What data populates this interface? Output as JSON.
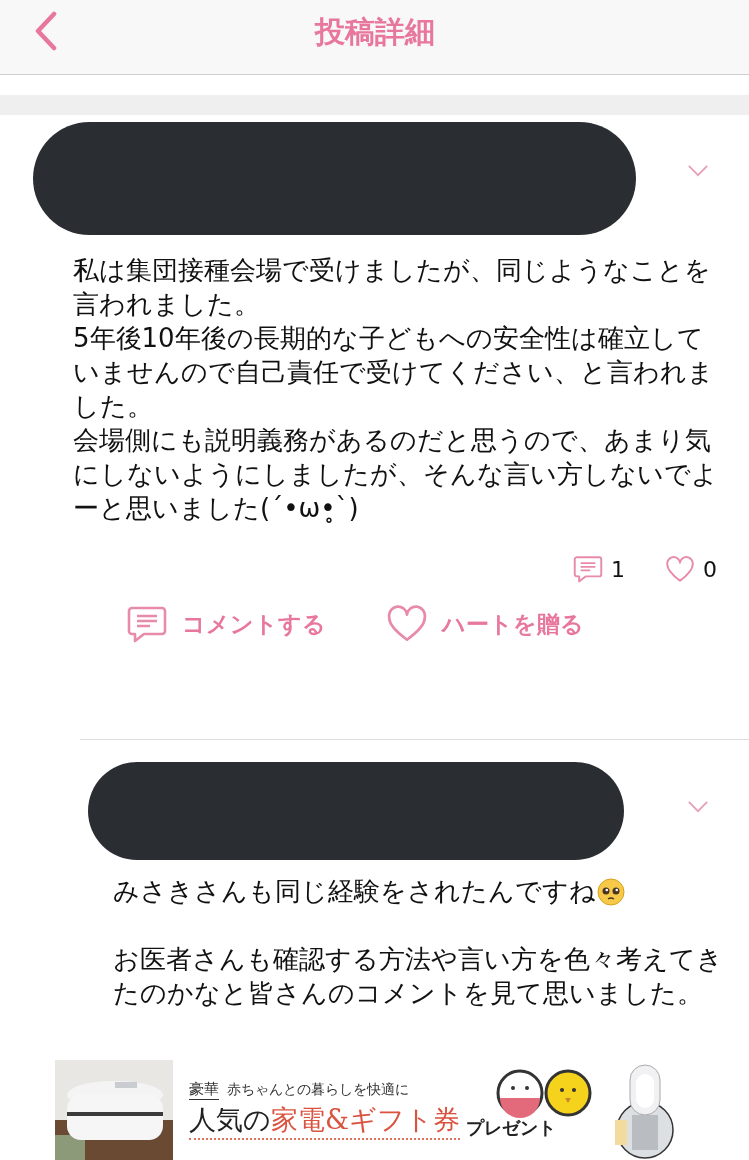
{
  "header": {
    "title": "投稿詳細"
  },
  "post": {
    "body_lines": [
      "私は集団接種会場で受けましたが、同じようなことを",
      "言われました。",
      "5年後10年後の長期的な子どもへの安全性は確立して",
      "いませんので自己責任で受けてください、と言われま",
      "した。",
      "会場側にも説明義務があるのだと思うので、あまり気",
      "にしないようにしましたが、そんな言い方しないでよ",
      "ーと思いました(´•ω•̥`)"
    ],
    "comment_count": "1",
    "heart_count": "0",
    "actions": [
      {
        "kind": "comment",
        "label": "コメントする"
      },
      {
        "kind": "heart",
        "label": "ハートを贈る"
      }
    ]
  },
  "reply": {
    "paragraphs": [
      {
        "lines": [
          "みさきさんも同じ経験をされたんですね"
        ],
        "trailing_emoji": true
      },
      {
        "lines": [
          "お医者さんも確認する方法や言い方を色々考えてき",
          "たのかなと皆さんのコメントを見て思いました。"
        ]
      }
    ]
  },
  "ad": {
    "tag": "豪華",
    "tagline": "赤ちゃんとの暮らしを快適に",
    "headline_lead": "人気の",
    "headline_main": "家電&ギフト券",
    "headline_tail": "プレゼント"
  }
}
